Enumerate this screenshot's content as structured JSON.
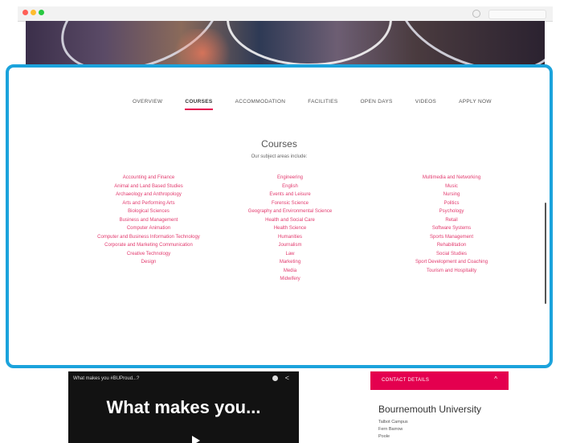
{
  "tabs": [
    "OVERVIEW",
    "COURSES",
    "ACCOMMODATION",
    "FACILITIES",
    "OPEN DAYS",
    "VIDEOS",
    "APPLY NOW"
  ],
  "active_tab": "COURSES",
  "courses": {
    "title": "Courses",
    "subtitle": "Our subject areas include:",
    "col1": [
      "Accounting and Finance",
      "Animal and Land Based Studies",
      "Archaeology and Anthropology",
      "Arts and Performing Arts",
      "Biological Sciences",
      "Business and Management",
      "Computer Animation",
      "Computer and Business Information Technology",
      "Corporate and Marketing Communication",
      "Creative Technology",
      "Design"
    ],
    "col2": [
      "Engineering",
      "English",
      "Events and Leisure",
      "Forensic Science",
      "Geography and Environmental Science",
      "Health and Social Care",
      "Health Science",
      "Humanities",
      "Journalism",
      "Law",
      "Marketing",
      "Media",
      "Midwifery"
    ],
    "col3": [
      "Multimedia and Networking",
      "Music",
      "Nursing",
      "Politics",
      "Psychology",
      "Retail",
      "Software Systems",
      "Sports Management",
      "Rehabilitation",
      "Social Studies",
      "Sport Development and Coaching",
      "Tourism and Hospitality"
    ]
  },
  "video": {
    "title": "What makes you #BUProud...?",
    "headline": "What makes you..."
  },
  "contact": {
    "label": "CONTACT DETAILS",
    "name": "Bournemouth University",
    "lines": [
      "Talbot Campus",
      "Fern Barrow",
      "Poole"
    ]
  },
  "colors": {
    "accent": "#e4004f",
    "highlight": "#1ba3dc",
    "link": "#e23a6e"
  }
}
